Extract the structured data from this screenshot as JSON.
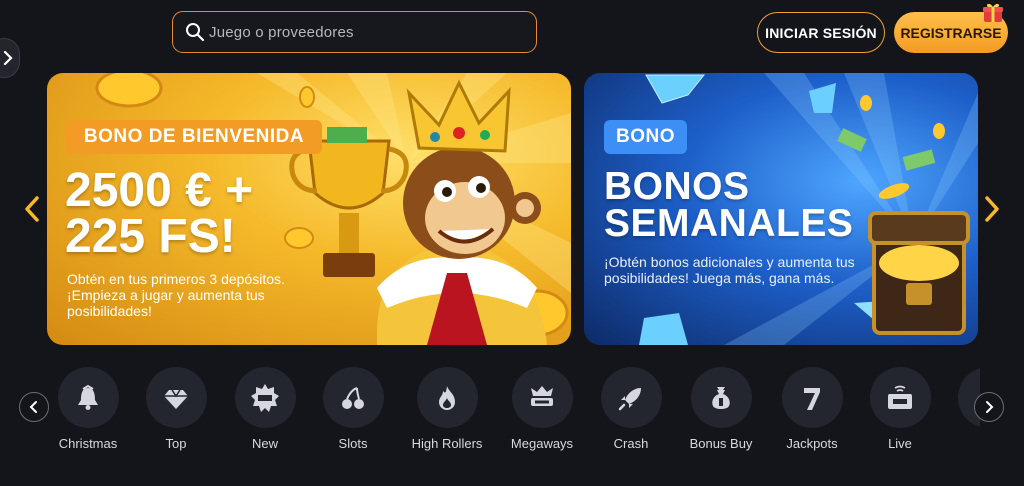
{
  "header": {
    "search": {
      "placeholder": "Juego o proveedores"
    },
    "login_label": "INICIAR SESIÓN",
    "register_label": "REGISTRARSE"
  },
  "banners": [
    {
      "badge": "BONO DE BIENVENIDA",
      "headline_line1": "2500 € +",
      "headline_line2": "225 FS!",
      "description": "Obtén en tus primeros 3 depósitos. ¡Empieza a jugar y aumenta tus posibilidades!",
      "accent": "#f29b25"
    },
    {
      "badge": "BONO",
      "headline_line1": "BONOS",
      "headline_line2": "SEMANALES",
      "description": "¡Obtén bonos adicionales y aumenta tus posibilidades! Juega más, gana más.",
      "accent": "#3d8ef5"
    }
  ],
  "categories": [
    {
      "label": "Christmas",
      "icon": "bell-icon"
    },
    {
      "label": "Top",
      "icon": "diamond-icon"
    },
    {
      "label": "New",
      "icon": "new-badge-icon"
    },
    {
      "label": "Slots",
      "icon": "cherries-icon"
    },
    {
      "label": "High Rollers",
      "icon": "flame-icon"
    },
    {
      "label": "Megaways",
      "icon": "crown-win-icon"
    },
    {
      "label": "Crash",
      "icon": "rocket-icon"
    },
    {
      "label": "Bonus Buy",
      "icon": "money-bag-icon"
    },
    {
      "label": "Jackpots",
      "icon": "seven-icon"
    },
    {
      "label": "Live",
      "icon": "live-tv-icon"
    }
  ],
  "colors": {
    "background": "#14151b",
    "brand_orange": "#f39b23",
    "card_circle": "#24262f"
  }
}
